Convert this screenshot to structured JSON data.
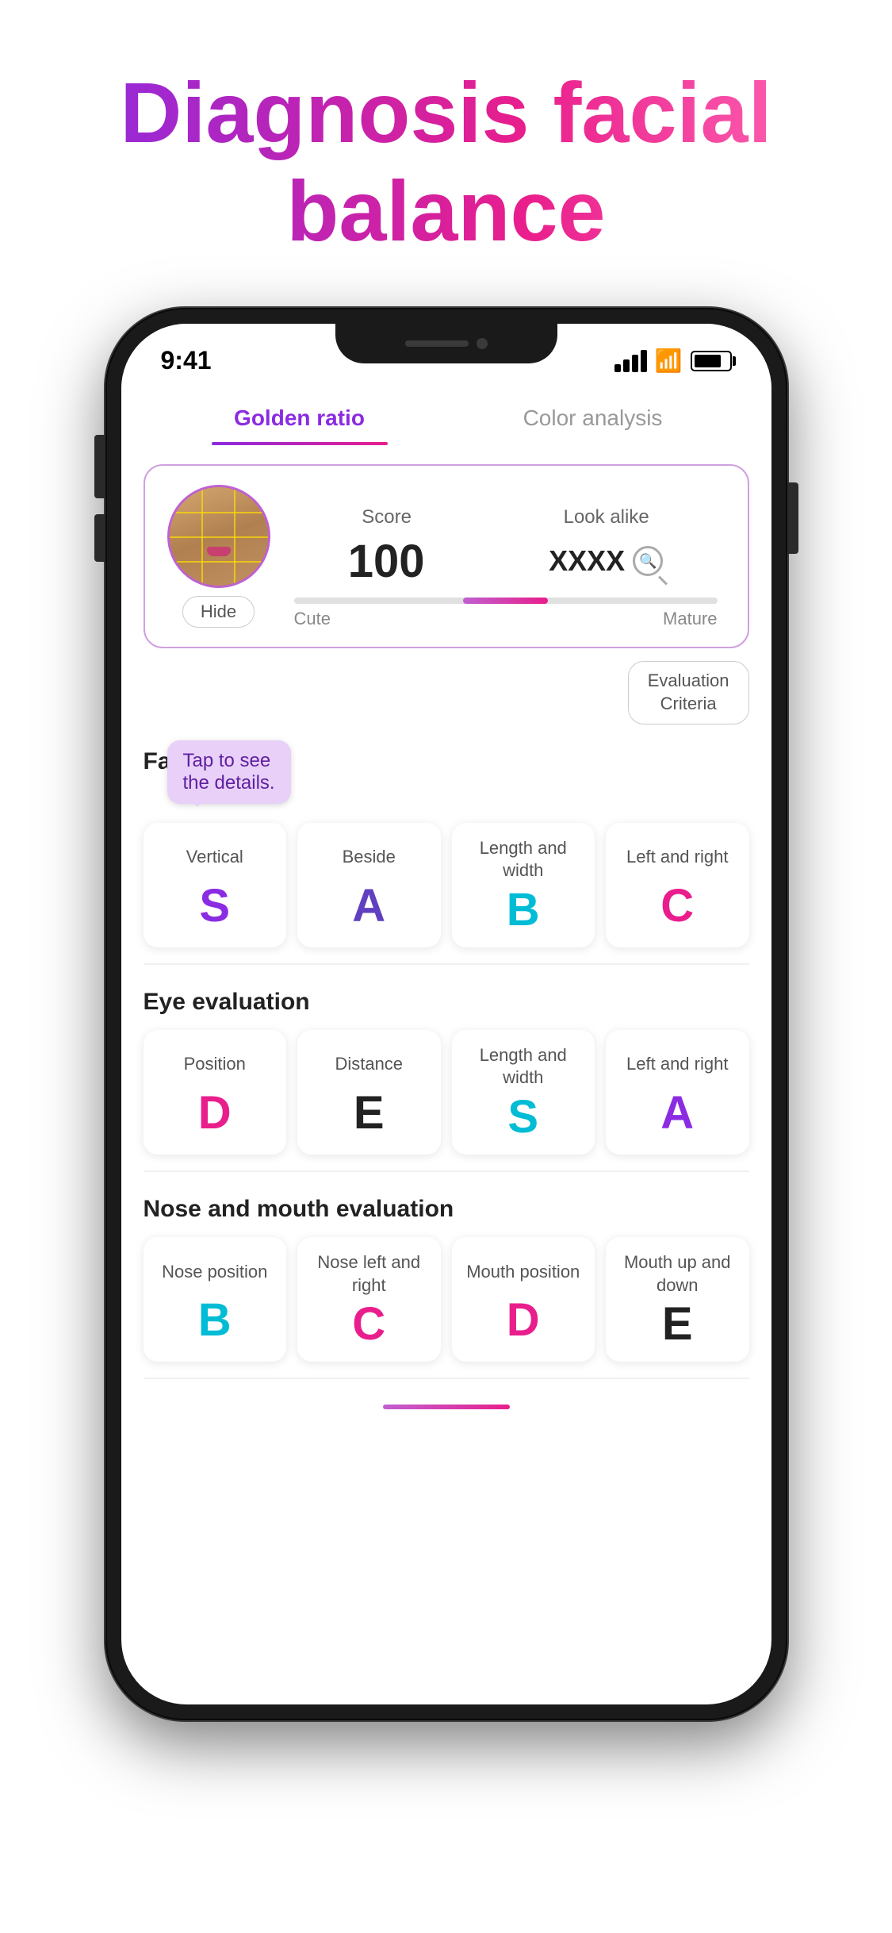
{
  "title": {
    "line1": "Diagnosis facial",
    "line2": "balance"
  },
  "status_bar": {
    "time": "9:41",
    "signal": "●●●●",
    "wifi": "WiFi",
    "battery": "Battery"
  },
  "tabs": [
    {
      "id": "golden-ratio",
      "label": "Golden ratio",
      "active": true
    },
    {
      "id": "color-analysis",
      "label": "Color analysis",
      "active": false
    }
  ],
  "score_card": {
    "hide_button": "Hide",
    "score_label": "Score",
    "look_alike_label": "Look alike",
    "score_value": "100",
    "look_alike_value": "XXXX",
    "slider_left": "Cute",
    "slider_right": "Mature"
  },
  "criteria_button": "Evaluation\nCriteria",
  "face_evaluation": {
    "section_title": "Face eva...",
    "tooltip": "Tap to see\nthe details.",
    "cards": [
      {
        "label": "Vertical",
        "grade": "S",
        "color": "purple"
      },
      {
        "label": "Beside",
        "grade": "A",
        "color": "blue-purple"
      },
      {
        "label": "Length and width",
        "grade": "B",
        "color": "cyan"
      },
      {
        "label": "Left and right",
        "grade": "C",
        "color": "pink"
      }
    ]
  },
  "eye_evaluation": {
    "section_title": "Eye evaluation",
    "cards": [
      {
        "label": "Position",
        "grade": "D",
        "color": "pink"
      },
      {
        "label": "Distance",
        "grade": "E",
        "color": "dark"
      },
      {
        "label": "Length and width",
        "grade": "S",
        "color": "cyan"
      },
      {
        "label": "Left and right",
        "grade": "A",
        "color": "purple"
      }
    ]
  },
  "nose_mouth_evaluation": {
    "section_title": "Nose and mouth evaluation",
    "cards": [
      {
        "label": "Nose position",
        "grade": "B",
        "color": "cyan"
      },
      {
        "label": "Nose left and right",
        "grade": "C",
        "color": "pink"
      },
      {
        "label": "Mouth position",
        "grade": "D",
        "color": "pink"
      },
      {
        "label": "Mouth up and down",
        "grade": "E",
        "color": "dark"
      }
    ]
  }
}
